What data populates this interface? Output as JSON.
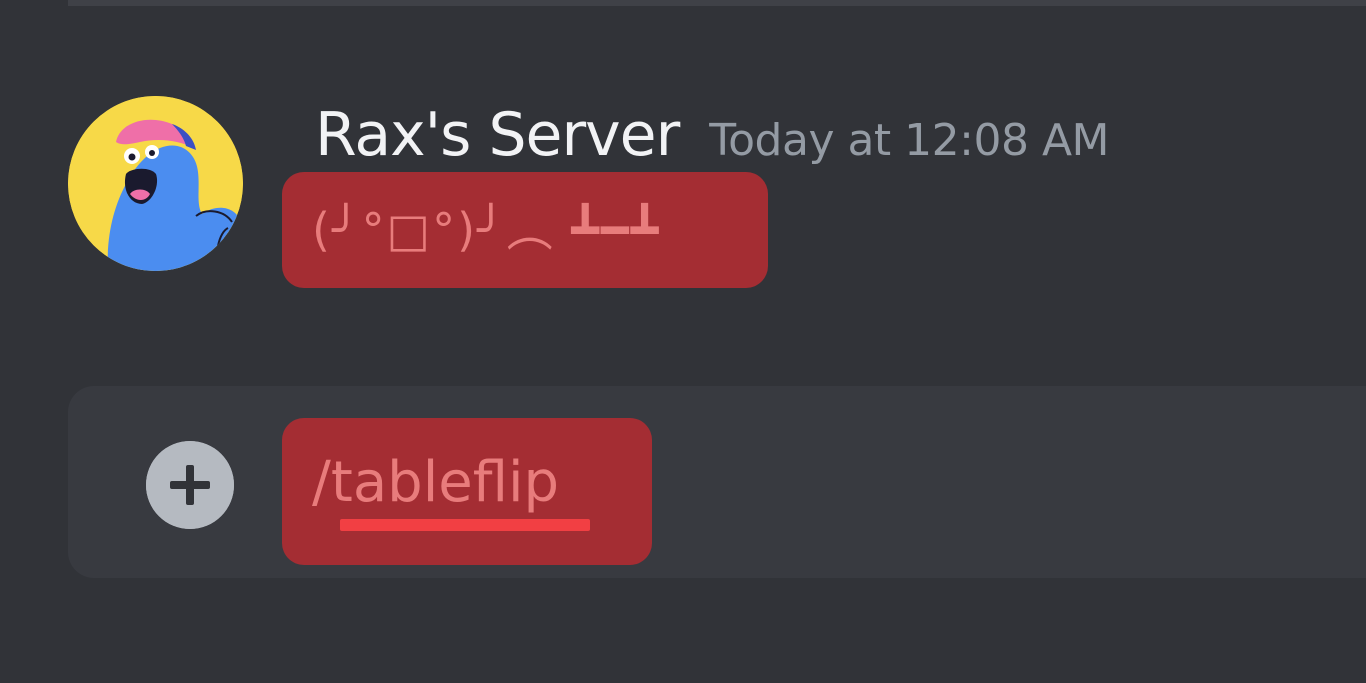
{
  "message": {
    "username": "Rax's Server",
    "timestamp": "Today at 12:08 AM",
    "content": "(╯°□°)╯︵ ┻━┻",
    "avatar": "cartoon-character-avatar"
  },
  "composer": {
    "add_icon": "plus-circle-icon",
    "input_value": "/tableflip"
  },
  "colors": {
    "background": "#313338",
    "composer_background": "#383a40",
    "highlight": "#a42d33",
    "highlight_text": "#e87c7c",
    "spellcheck_underline": "#f23f43",
    "username": "#f2f3f5",
    "timestamp": "#949ba4",
    "avatar_background": "#f7d948"
  }
}
